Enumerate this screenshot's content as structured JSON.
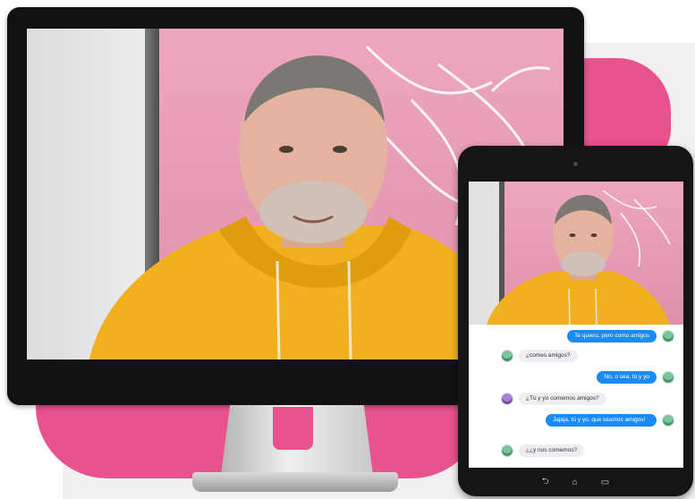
{
  "page": {
    "title": ""
  },
  "colors": {
    "accent_pink": "#e8528e",
    "bubble_outgoing": "#1b8af2",
    "bubble_incoming": "#eceef2",
    "hoodie": "#f2b01e"
  },
  "monitor": {
    "screen_content": "video-frame-person-in-yellow-hoodie"
  },
  "tablet": {
    "video_content": "video-frame-person-in-yellow-hoodie",
    "chat": [
      {
        "side": "out",
        "text": "Te quiero, pero como amigos"
      },
      {
        "side": "in",
        "text": "¿comes amigos?"
      },
      {
        "side": "out",
        "text": "No, o sea, tú y yo"
      },
      {
        "side": "in",
        "text": "¿Tú y yo comemos amigos?"
      },
      {
        "side": "out",
        "text": "Jajaja, tú y yo, que seamos amigos!"
      },
      {
        "side": "in",
        "text": "¿¿y nos comemos?"
      }
    ],
    "nav": {
      "back": "back-icon",
      "home": "home-icon",
      "recents": "recents-icon"
    }
  }
}
